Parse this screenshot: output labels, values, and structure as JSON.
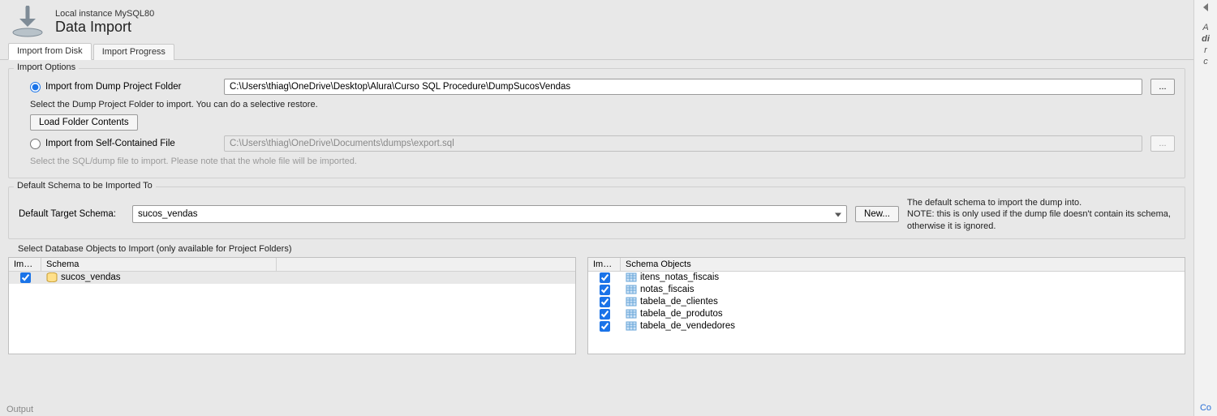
{
  "header": {
    "instance": "Local instance MySQL80",
    "title": "Data Import"
  },
  "tabs": [
    {
      "label": "Import from Disk",
      "active": true
    },
    {
      "label": "Import Progress",
      "active": false
    }
  ],
  "import_options": {
    "legend": "Import Options",
    "opt1": {
      "label": "Import from Dump Project Folder",
      "path": "C:\\Users\\thiag\\OneDrive\\Desktop\\Alura\\Curso SQL Procedure\\DumpSucosVendas",
      "hint": "Select the Dump Project Folder to import. You can do a selective restore.",
      "browse": "...",
      "selected": true
    },
    "load_btn": "Load Folder Contents",
    "opt2": {
      "label": "Import from Self-Contained File",
      "path": "C:\\Users\\thiag\\OneDrive\\Documents\\dumps\\export.sql",
      "hint": "Select the SQL/dump file to import. Please note that the whole file will be imported.",
      "browse": "...",
      "selected": false
    }
  },
  "default_schema": {
    "legend": "Default Schema to be Imported To",
    "label": "Default Target Schema:",
    "value": "sucos_vendas",
    "new_btn": "New...",
    "note": "The default schema to import the dump into.\nNOTE: this is only used if the dump file doesn't contain its schema, otherwise it is ignored."
  },
  "objects": {
    "legend": "Select Database Objects to Import (only available for Project Folders)",
    "schemas": {
      "headers": [
        "Imp...",
        "Schema"
      ],
      "rows": [
        {
          "checked": true,
          "name": "sucos_vendas"
        }
      ]
    },
    "schema_objects": {
      "headers": [
        "Imp...",
        "Schema Objects"
      ],
      "rows": [
        {
          "checked": true,
          "name": "itens_notas_fiscais"
        },
        {
          "checked": true,
          "name": "notas_fiscais"
        },
        {
          "checked": true,
          "name": "tabela_de_clientes"
        },
        {
          "checked": true,
          "name": "tabela_de_produtos"
        },
        {
          "checked": true,
          "name": "tabela_de_vendedores"
        }
      ]
    }
  },
  "output_label": "Output"
}
